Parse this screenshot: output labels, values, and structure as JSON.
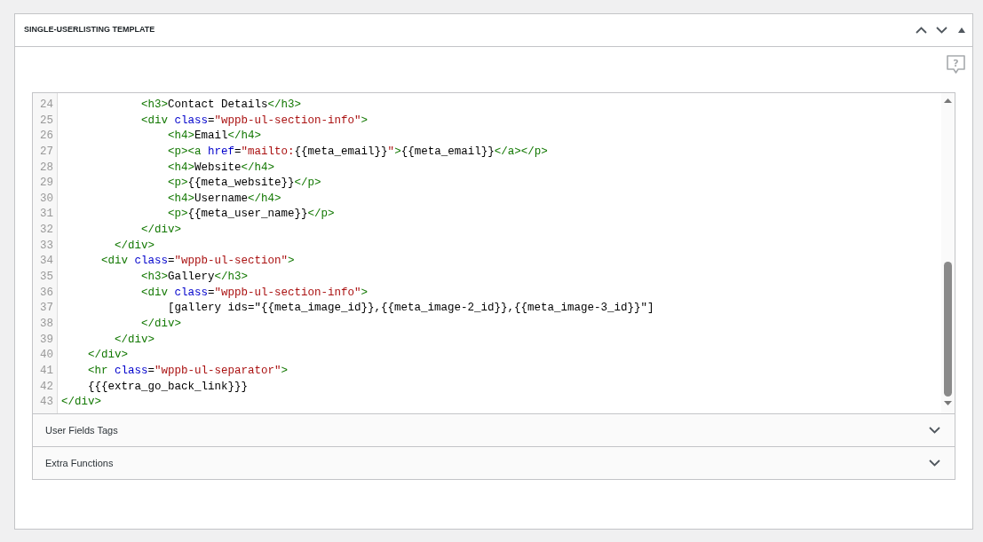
{
  "panel": {
    "title": "SINGLE-USERLISTING TEMPLATE",
    "help_mark": "?"
  },
  "code_lines": [
    {
      "number": "24",
      "tokens": [
        {
          "kind": "tag",
          "text": "            <h3>"
        },
        {
          "kind": "text",
          "text": "Contact Details"
        },
        {
          "kind": "tag",
          "text": "</h3>"
        }
      ]
    },
    {
      "number": "25",
      "tokens": [
        {
          "kind": "tag",
          "text": "            <div "
        },
        {
          "kind": "attr",
          "text": "class"
        },
        {
          "kind": "text",
          "text": "="
        },
        {
          "kind": "string",
          "text": "\"wppb-ul-section-info\""
        },
        {
          "kind": "tag",
          "text": ">"
        }
      ]
    },
    {
      "number": "26",
      "tokens": [
        {
          "kind": "tag",
          "text": "                <h4>"
        },
        {
          "kind": "text",
          "text": "Email"
        },
        {
          "kind": "tag",
          "text": "</h4>"
        }
      ]
    },
    {
      "number": "27",
      "tokens": [
        {
          "kind": "tag",
          "text": "                <p><a "
        },
        {
          "kind": "attr",
          "text": "href"
        },
        {
          "kind": "text",
          "text": "="
        },
        {
          "kind": "string",
          "text": "\"mailto:"
        },
        {
          "kind": "text",
          "text": "{{meta_email}}"
        },
        {
          "kind": "string",
          "text": "\""
        },
        {
          "kind": "tag",
          "text": ">"
        },
        {
          "kind": "text",
          "text": "{{meta_email}}"
        },
        {
          "kind": "tag",
          "text": "</a></p>"
        }
      ]
    },
    {
      "number": "28",
      "tokens": [
        {
          "kind": "tag",
          "text": "                <h4>"
        },
        {
          "kind": "text",
          "text": "Website"
        },
        {
          "kind": "tag",
          "text": "</h4>"
        }
      ]
    },
    {
      "number": "29",
      "tokens": [
        {
          "kind": "tag",
          "text": "                <p>"
        },
        {
          "kind": "text",
          "text": "{{meta_website}}"
        },
        {
          "kind": "tag",
          "text": "</p>"
        }
      ]
    },
    {
      "number": "30",
      "tokens": [
        {
          "kind": "tag",
          "text": "                <h4>"
        },
        {
          "kind": "text",
          "text": "Username"
        },
        {
          "kind": "tag",
          "text": "</h4>"
        }
      ]
    },
    {
      "number": "31",
      "tokens": [
        {
          "kind": "tag",
          "text": "                <p>"
        },
        {
          "kind": "text",
          "text": "{{meta_user_name}}"
        },
        {
          "kind": "tag",
          "text": "</p>"
        }
      ]
    },
    {
      "number": "32",
      "tokens": [
        {
          "kind": "tag",
          "text": "            </div>"
        }
      ]
    },
    {
      "number": "33",
      "tokens": [
        {
          "kind": "tag",
          "text": "        </div>"
        }
      ]
    },
    {
      "number": "34",
      "tokens": [
        {
          "kind": "tag",
          "text": "      <div "
        },
        {
          "kind": "attr",
          "text": "class"
        },
        {
          "kind": "text",
          "text": "="
        },
        {
          "kind": "string",
          "text": "\"wppb-ul-section\""
        },
        {
          "kind": "tag",
          "text": ">"
        }
      ]
    },
    {
      "number": "35",
      "tokens": [
        {
          "kind": "tag",
          "text": "            <h3>"
        },
        {
          "kind": "text",
          "text": "Gallery"
        },
        {
          "kind": "tag",
          "text": "</h3>"
        }
      ]
    },
    {
      "number": "36",
      "tokens": [
        {
          "kind": "tag",
          "text": "            <div "
        },
        {
          "kind": "attr",
          "text": "class"
        },
        {
          "kind": "text",
          "text": "="
        },
        {
          "kind": "string",
          "text": "\"wppb-ul-section-info\""
        },
        {
          "kind": "tag",
          "text": ">"
        }
      ]
    },
    {
      "number": "37",
      "tokens": [
        {
          "kind": "text",
          "text": "                [gallery ids=\"{{meta_image_id}},{{meta_image-2_id}},{{meta_image-3_id}}\"]"
        }
      ]
    },
    {
      "number": "38",
      "tokens": [
        {
          "kind": "tag",
          "text": "            </div>"
        }
      ]
    },
    {
      "number": "39",
      "tokens": [
        {
          "kind": "tag",
          "text": "        </div>"
        }
      ]
    },
    {
      "number": "40",
      "tokens": [
        {
          "kind": "tag",
          "text": "    </div>"
        }
      ]
    },
    {
      "number": "41",
      "tokens": [
        {
          "kind": "tag",
          "text": "    <hr "
        },
        {
          "kind": "attr",
          "text": "class"
        },
        {
          "kind": "text",
          "text": "="
        },
        {
          "kind": "string",
          "text": "\"wppb-ul-separator\""
        },
        {
          "kind": "tag",
          "text": ">"
        }
      ]
    },
    {
      "number": "42",
      "tokens": [
        {
          "kind": "text",
          "text": "    {{{extra_go_back_link}}}"
        }
      ]
    },
    {
      "number": "43",
      "tokens": [
        {
          "kind": "tag",
          "text": "</div>"
        }
      ]
    }
  ],
  "sections": [
    {
      "label": "User Fields Tags",
      "expanded": false
    },
    {
      "label": "Extra Functions",
      "expanded": false
    }
  ]
}
